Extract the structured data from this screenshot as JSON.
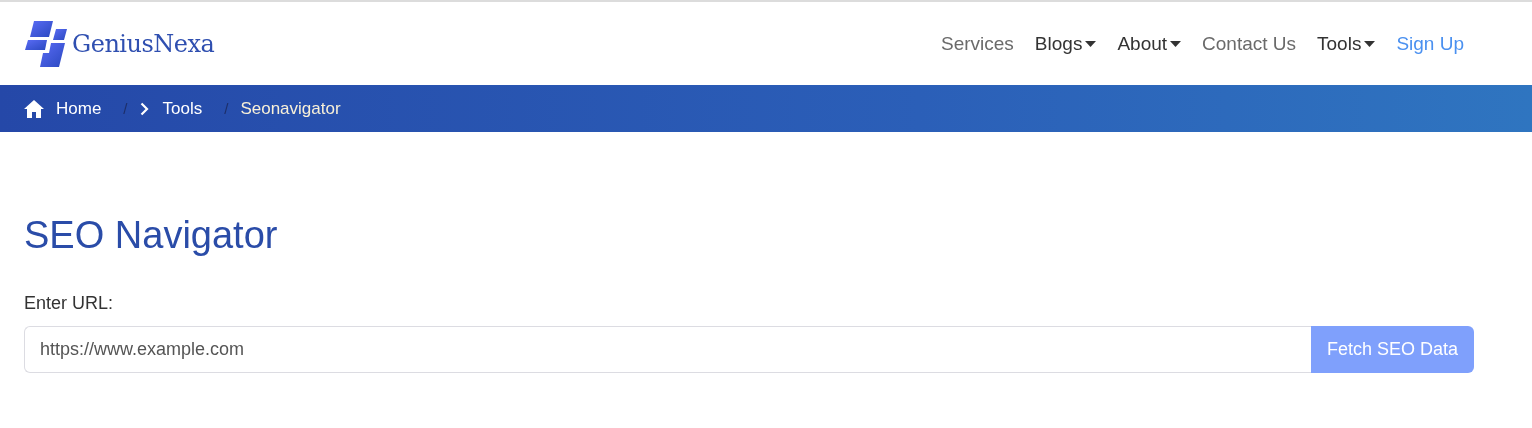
{
  "logo": {
    "text": "GeniusNexa"
  },
  "nav": [
    {
      "label": "Services",
      "kind": "link"
    },
    {
      "label": "Blogs",
      "kind": "dropdown"
    },
    {
      "label": "About",
      "kind": "dropdown"
    },
    {
      "label": "Contact Us",
      "kind": "link"
    },
    {
      "label": "Tools",
      "kind": "dropdown"
    },
    {
      "label": "Sign Up",
      "kind": "signup"
    }
  ],
  "breadcrumb": [
    {
      "label": "Home",
      "kind": "home"
    },
    {
      "label": "Tools",
      "kind": "chevron",
      "separator": "/"
    },
    {
      "label": "Seonavigator",
      "kind": "current",
      "separator": "/"
    }
  ],
  "title": "SEO Navigator",
  "form": {
    "label": "Enter URL:",
    "placeholder": "https://www.example.com",
    "button": "Fetch SEO Data",
    "button_disabled": true
  }
}
